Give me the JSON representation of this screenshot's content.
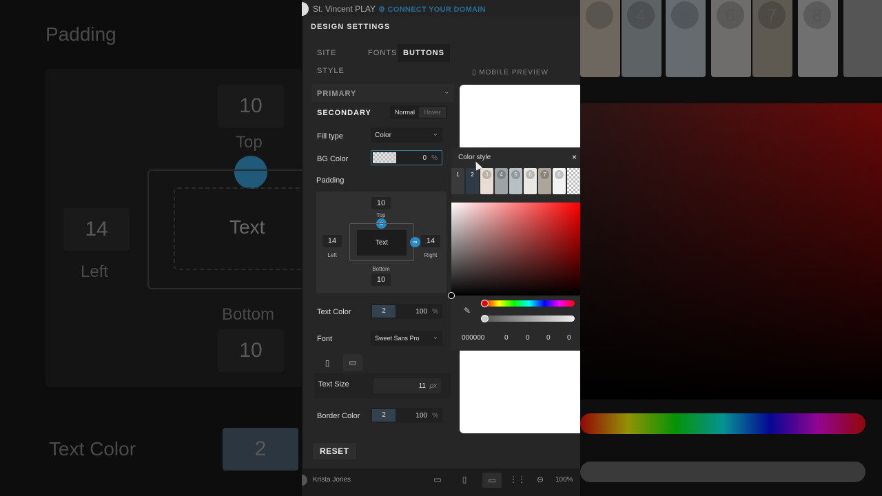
{
  "topbar": {
    "site_name": "St. Vincent PLAY",
    "domain_link": "⚙ CONNECT YOUR DOMAIN"
  },
  "dialog": {
    "title": "DESIGN SETTINGS",
    "tabs": [
      "SITE STYLE",
      "FONTS",
      "BUTTONS"
    ],
    "mobile_preview": "MOBILE PREVIEW",
    "primary": "PRIMARY",
    "secondary": "SECONDARY",
    "state_normal": "Normal",
    "state_hover": "Hover",
    "fill_type_label": "Fill type",
    "fill_type_value": "Color",
    "bg_color_label": "BG Color",
    "bg_color_value": "0",
    "percent": "%",
    "padding_label": "Padding",
    "padding": {
      "top": "10",
      "left": "14",
      "right": "14",
      "bottom": "10",
      "top_label": "Top",
      "left_label": "Left",
      "right_label": "Right",
      "bottom_label": "Bottom",
      "preview_text": "Text"
    },
    "text_color_label": "Text Color",
    "text_color_swatch": "2",
    "text_color_value": "100",
    "font_label": "Font",
    "font_value": "Sweet Sans Pro",
    "text_size_label": "Text Size",
    "text_size_value": "11",
    "text_size_unit": "px",
    "border_color_label": "Border Color",
    "border_color_swatch": "2",
    "border_color_value": "100",
    "reset_label": "RESET"
  },
  "color_picker": {
    "title": "Color style",
    "close": "×",
    "swatches": [
      {
        "label": "1",
        "color": "#3a3a3a"
      },
      {
        "label": "2",
        "color": "#2f3a46"
      },
      {
        "label": "3",
        "color": "#e8ddd2"
      },
      {
        "label": "4",
        "color": "#9ea4a6"
      },
      {
        "label": "5",
        "color": "#b7c0c4"
      },
      {
        "label": "6",
        "color": "#e9e8e3"
      },
      {
        "label": "7",
        "color": "#aca69a"
      },
      {
        "label": "8",
        "color": "#f3f3f3"
      }
    ],
    "hex": "000000",
    "r": "0",
    "g": "0",
    "b": "0",
    "a": "0"
  },
  "bottombar": {
    "user": "Krista Jones",
    "zoom": "100%"
  },
  "background_zoom": {
    "padding": "Padding",
    "top": "10",
    "top_label": "Top",
    "left": "14",
    "left_label": "Left",
    "text": "Text",
    "bottom_label": "Bottom",
    "bottom": "10",
    "text_color": "Text Color",
    "swatch": "2",
    "swatches": [
      "3",
      "4",
      "5",
      "6",
      "7",
      "8"
    ]
  }
}
